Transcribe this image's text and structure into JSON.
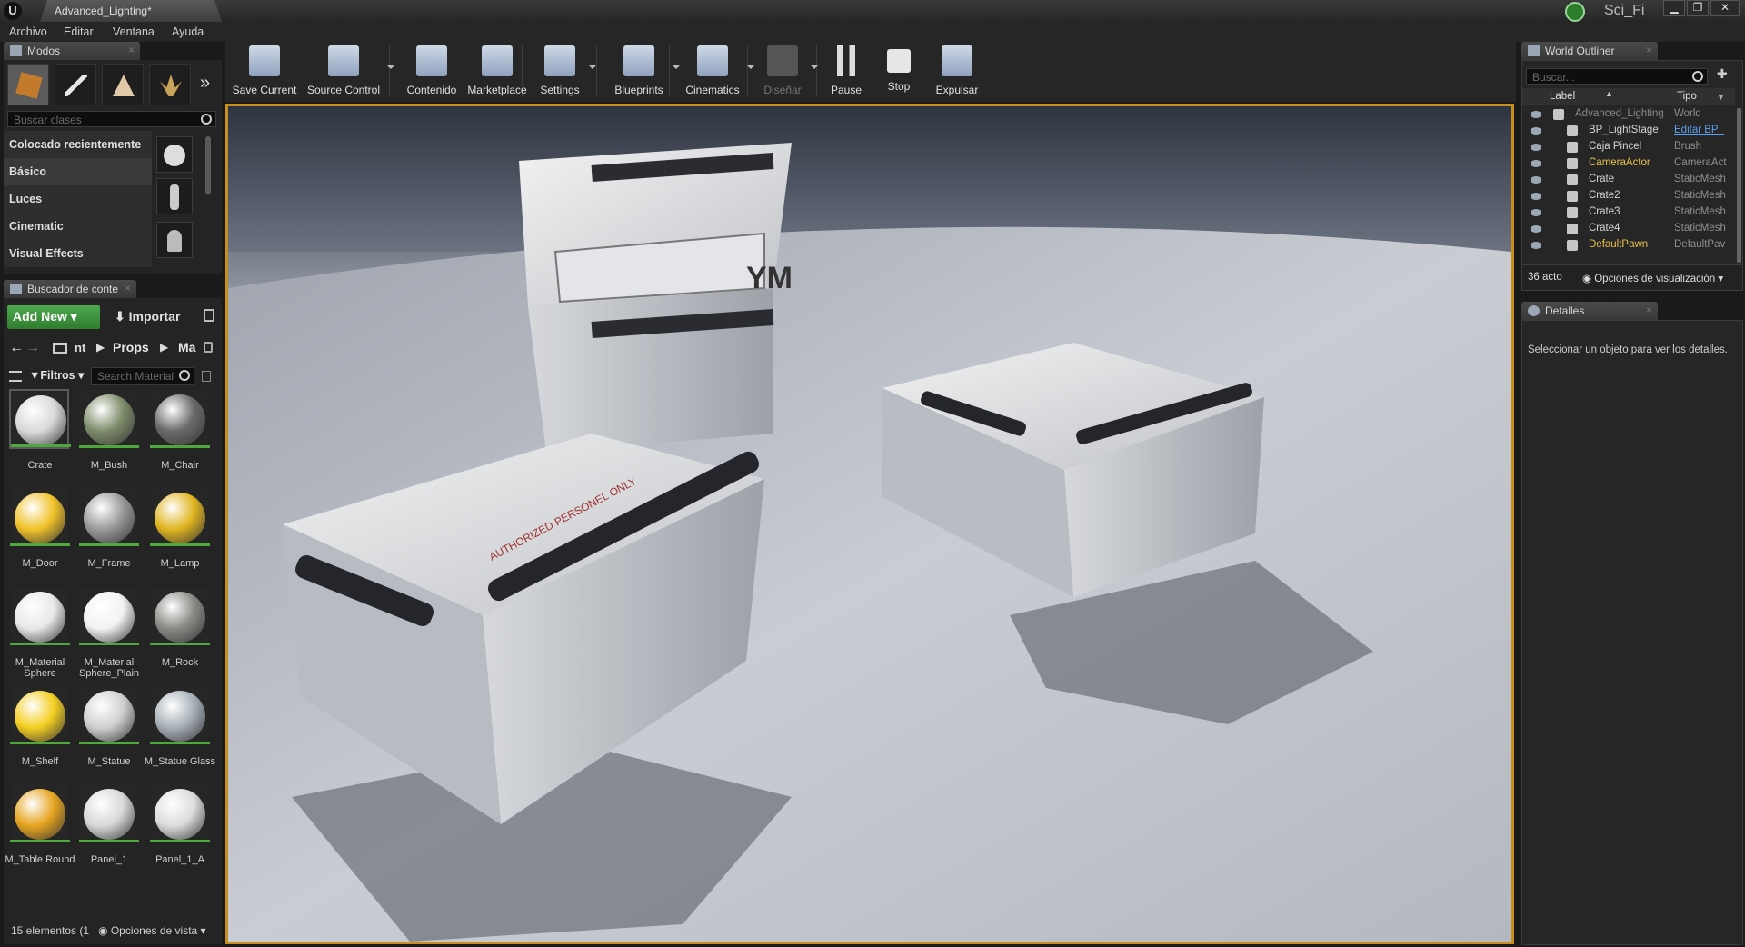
{
  "window": {
    "tab_title": "Advanced_Lighting*",
    "project_name": "Sci_Fi",
    "minimize": "▁",
    "restore": "❐",
    "close": "✕"
  },
  "menu": [
    "Archivo",
    "Editar",
    "Ventana",
    "Ayuda"
  ],
  "modes_panel": {
    "tab_label": "Modos",
    "search_placeholder": "Buscar clases",
    "more": "»",
    "categories": [
      "Colocado recientemente",
      "Básico",
      "Luces",
      "Cinematic",
      "Visual Effects"
    ],
    "selected_category": "Básico"
  },
  "content_browser": {
    "tab_label": "Buscador de conte",
    "add_new": "Add New ▾",
    "import": "Importar",
    "path": [
      "nt",
      "Props",
      "Ma"
    ],
    "filters": "Filtros ▾",
    "search_placeholder": "Search Material",
    "assets": [
      {
        "name": "Crate",
        "color": "#d8d8d8",
        "selected": true
      },
      {
        "name": "M_Bush",
        "color": "#7e8c6a"
      },
      {
        "name": "M_Chair",
        "color": "#6a6a6a"
      },
      {
        "name": "M_Door",
        "color": "#f0c22a"
      },
      {
        "name": "M_Frame",
        "color": "#9a9a9a"
      },
      {
        "name": "M_Lamp",
        "color": "#e0b520"
      },
      {
        "name": "M_Material Sphere",
        "color": "#e8e8e8"
      },
      {
        "name": "M_Material Sphere_Plain",
        "color": "#f2f2f2"
      },
      {
        "name": "M_Rock",
        "color": "#8a8a86"
      },
      {
        "name": "M_Shelf",
        "color": "#f4cf22"
      },
      {
        "name": "M_Statue",
        "color": "#d0d0d0"
      },
      {
        "name": "M_Statue Glass",
        "color": "#a8b0b8"
      },
      {
        "name": "M_Table Round",
        "color": "#e6a520"
      },
      {
        "name": "Panel_1",
        "color": "#d8d8d8"
      },
      {
        "name": "Panel_1_A",
        "color": "#dcdcdc"
      }
    ],
    "status": "15 elementos (1",
    "view_options": "Opciones de vista ▾"
  },
  "toolbar": [
    {
      "label": "Save Current",
      "dropdown": false,
      "enabled": true
    },
    {
      "label": "Source Control",
      "dropdown": true,
      "enabled": true
    },
    {
      "label": "Contenido",
      "dropdown": false,
      "enabled": true
    },
    {
      "label": "Marketplace",
      "dropdown": false,
      "enabled": true
    },
    {
      "label": "Settings",
      "dropdown": true,
      "enabled": true
    },
    {
      "label": "Blueprints",
      "dropdown": true,
      "enabled": true
    },
    {
      "label": "Cinematics",
      "dropdown": true,
      "enabled": true
    },
    {
      "label": "Diseñar",
      "dropdown": true,
      "enabled": false
    },
    {
      "label": "Pause",
      "dropdown": false,
      "enabled": true
    },
    {
      "label": "Stop",
      "dropdown": false,
      "enabled": true
    },
    {
      "label": "Expulsar",
      "dropdown": false,
      "enabled": true
    }
  ],
  "viewport": {
    "crate_marking": "AUTHORIZED PERSONEL ONLY",
    "logo": "YM"
  },
  "world_outliner": {
    "tab_label": "World Outliner",
    "search_placeholder": "Buscar...",
    "col_label": "Label",
    "col_type": "Tipo",
    "rows": [
      {
        "label": "Advanced_Lighting",
        "type": "World",
        "highlight": false,
        "muted": true
      },
      {
        "label": "BP_LightStage",
        "type": "Editar BP_",
        "highlight": false,
        "link": true
      },
      {
        "label": "Caja Pincel",
        "type": "Brush"
      },
      {
        "label": "CameraActor",
        "type": "CameraAct",
        "highlight": true
      },
      {
        "label": "Crate",
        "type": "StaticMesh"
      },
      {
        "label": "Crate2",
        "type": "StaticMesh"
      },
      {
        "label": "Crate3",
        "type": "StaticMesh"
      },
      {
        "label": "Crate4",
        "type": "StaticMesh"
      },
      {
        "label": "DefaultPawn",
        "type": "DefaultPav",
        "highlight": true
      }
    ],
    "status": "36 acto",
    "view_options": "Opciones de visualización ▾"
  },
  "details": {
    "tab_label": "Detalles",
    "empty_text": "Seleccionar un objeto para ver los detalles."
  },
  "colors": {
    "viewport_border": "#c88f1e",
    "green": "#3e8f3e",
    "highlight": "#e8c348",
    "link": "#5aa0f0"
  }
}
